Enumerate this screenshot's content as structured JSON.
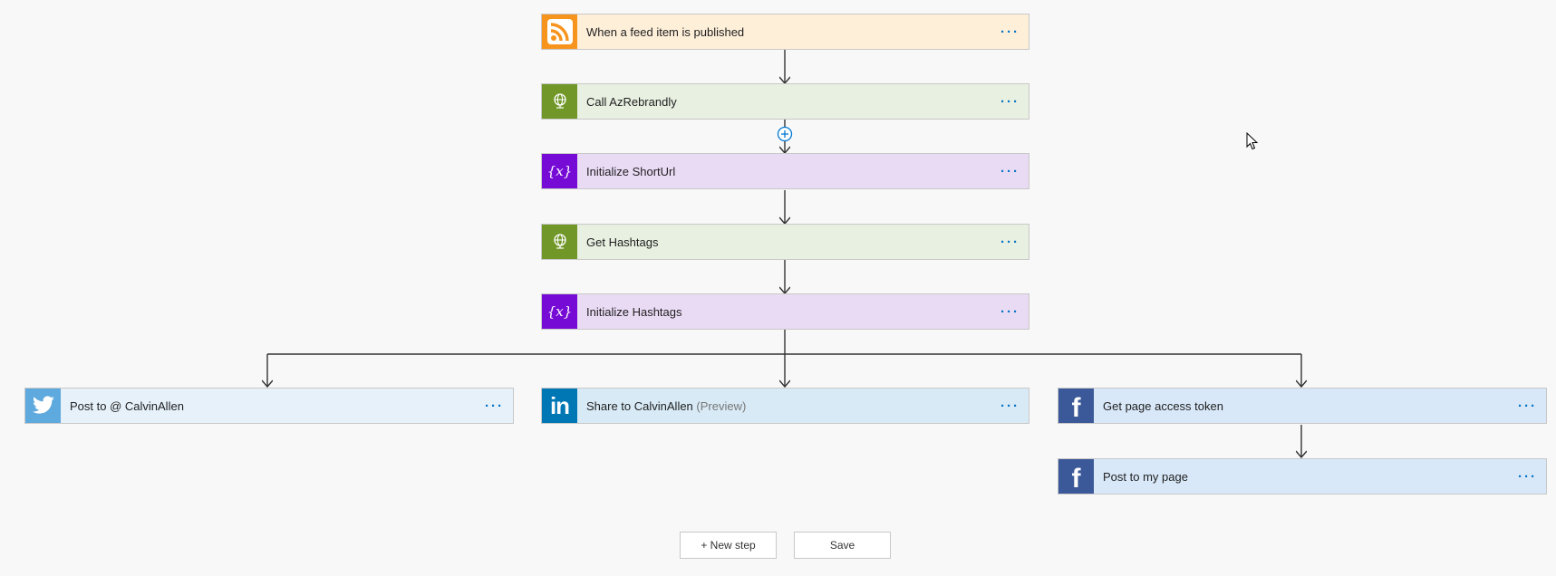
{
  "steps": {
    "trigger": {
      "label": "When a feed item is published",
      "more": "···",
      "icon": "rss-icon",
      "color": "#feefd9"
    },
    "call_azrebrandly": {
      "label": "Call AzRebrandly",
      "more": "···",
      "icon": "http-globe-icon",
      "color": "#e8f0e1"
    },
    "init_shorturl": {
      "label": "Initialize ShortUrl",
      "more": "···",
      "icon": "variable-icon",
      "color": "#eadbf5"
    },
    "get_hashtags": {
      "label": "Get Hashtags",
      "more": "···",
      "icon": "http-globe-icon",
      "color": "#e8f0e1"
    },
    "init_hashtags": {
      "label": "Initialize Hashtags",
      "more": "···",
      "icon": "variable-icon",
      "color": "#eadbf5"
    },
    "post_twitter": {
      "label": "Post to @ CalvinAllen",
      "more": "···",
      "icon": "twitter-icon",
      "color": "#e6f1fa"
    },
    "share_linkedin": {
      "label": "Share to CalvinAllen",
      "suffix": "(Preview)",
      "more": "···",
      "icon": "linkedin-icon",
      "color": "#d8eaf6"
    },
    "get_token": {
      "label": "Get page access token",
      "more": "···",
      "icon": "facebook-icon",
      "color": "#d8e8f8"
    },
    "post_page": {
      "label": "Post to my page",
      "more": "···",
      "icon": "facebook-icon",
      "color": "#d8e8f8"
    }
  },
  "icons": {
    "variable_text": "{x}",
    "linkedin_text": "in",
    "facebook_text": "f"
  },
  "buttons": {
    "new_step": "+ New step",
    "save": "Save"
  }
}
